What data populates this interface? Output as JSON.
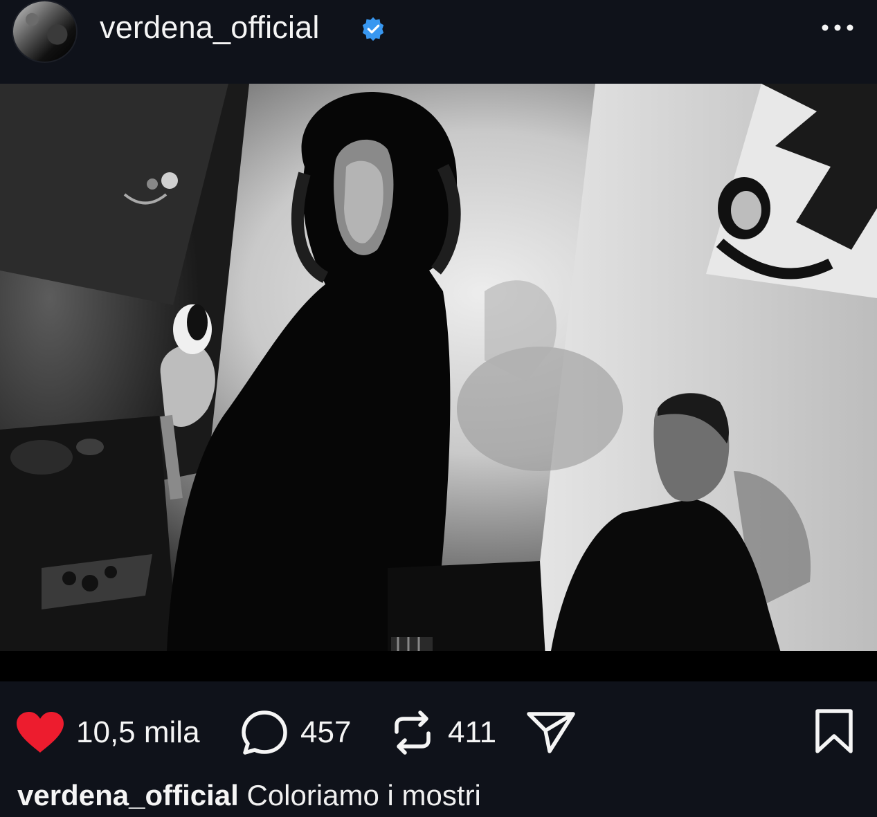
{
  "post": {
    "username": "verdena_official",
    "verified": true,
    "menu_icon": "more-horizontal-icon"
  },
  "image": {
    "description_alt": "",
    "style": "black-and-white"
  },
  "actions": {
    "likes": "10,5 mila",
    "liked": true,
    "comments": "457",
    "reposts": "411",
    "like_color": "#ed1c2e",
    "icons": [
      "heart-icon",
      "comment-icon",
      "repost-icon",
      "share-icon",
      "bookmark-icon"
    ]
  },
  "caption": {
    "username": "verdena_official",
    "text": "Coloriamo i mostri"
  },
  "colors": {
    "background": "#0f121a",
    "verified_badge": "#3897f0",
    "text": "#f5f5f5"
  }
}
